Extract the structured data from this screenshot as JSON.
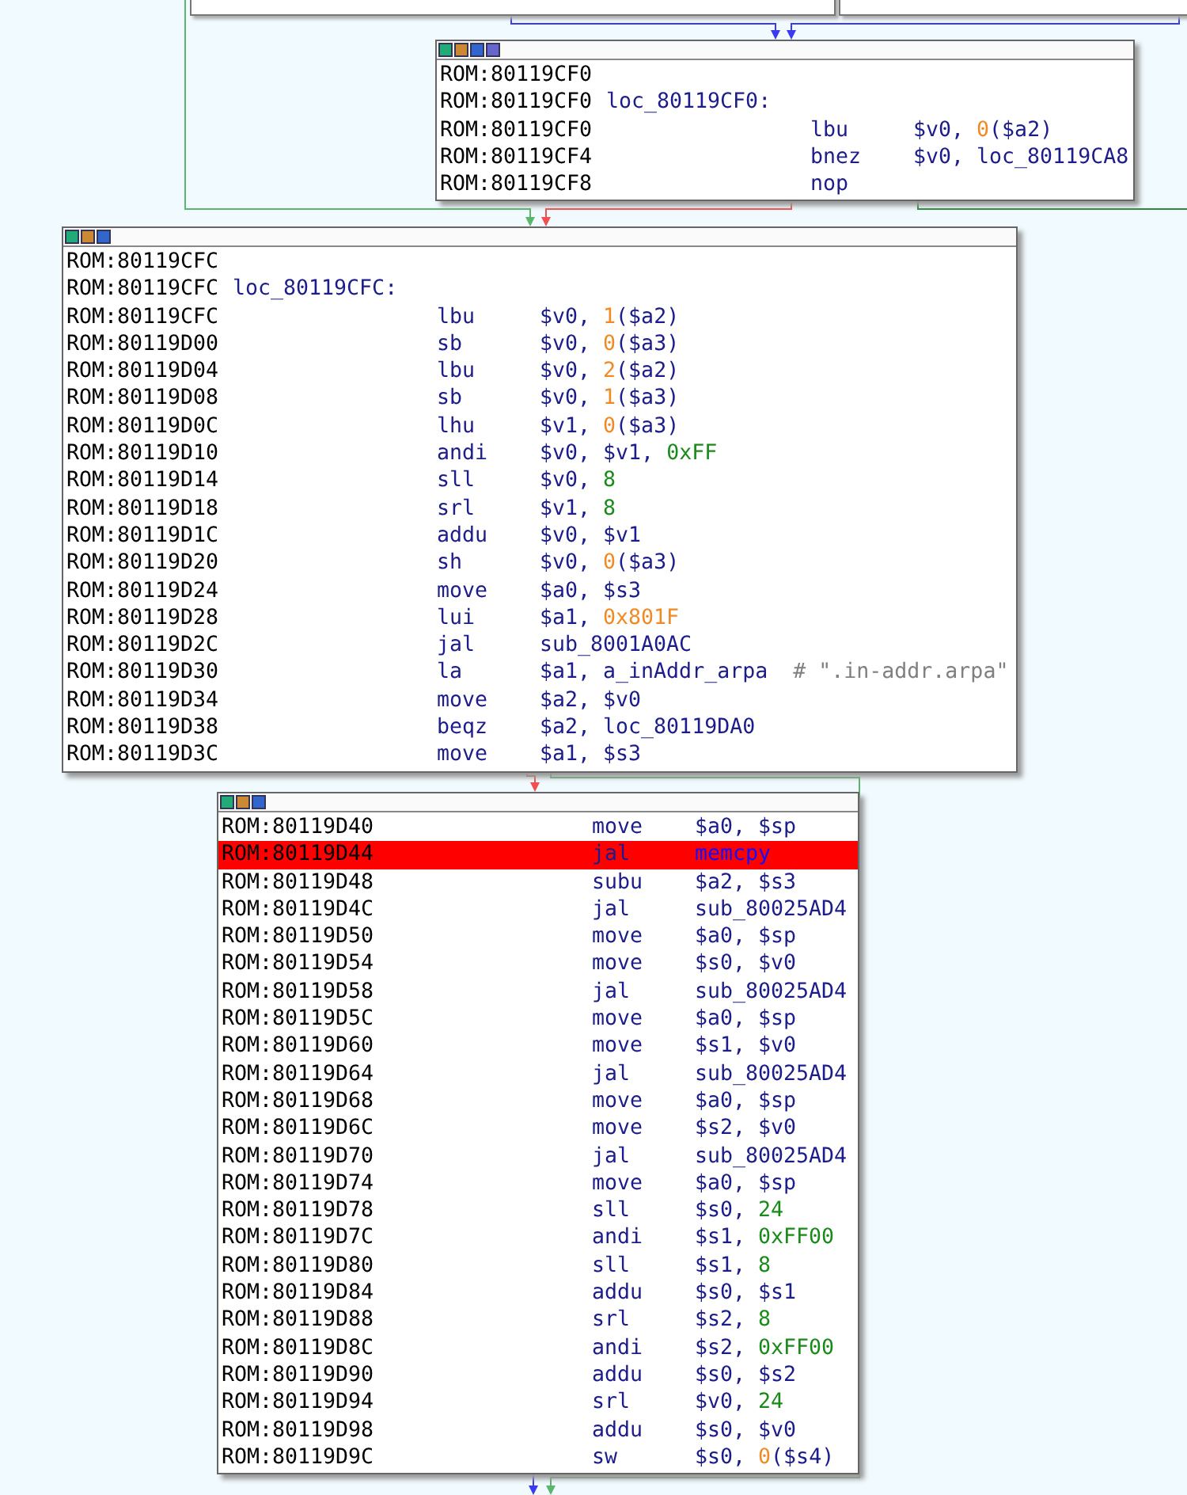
{
  "blocks": [
    {
      "lines": [
        {
          "address": "ROM:80119CF0"
        },
        {
          "address": "ROM:80119CF0",
          "label": "loc_80119CF0:"
        },
        {
          "address": "ROM:80119CF0",
          "mnemonic": "lbu",
          "operands": [
            {
              "text": "$v0, ",
              "kind": "reg"
            },
            {
              "text": "0",
              "kind": "offset"
            },
            {
              "text": "($a2)",
              "kind": "reg"
            }
          ]
        },
        {
          "address": "ROM:80119CF4",
          "mnemonic": "bnez",
          "operands": [
            {
              "text": "$v0, loc_80119CA8",
              "kind": "reg"
            }
          ]
        },
        {
          "address": "ROM:80119CF8",
          "mnemonic": "nop"
        }
      ]
    },
    {
      "lines": [
        {
          "address": "ROM:80119CFC"
        },
        {
          "address": "ROM:80119CFC",
          "label": "loc_80119CFC:"
        },
        {
          "address": "ROM:80119CFC",
          "mnemonic": "lbu",
          "operands": [
            {
              "text": "$v0, ",
              "kind": "reg"
            },
            {
              "text": "1",
              "kind": "offset"
            },
            {
              "text": "($a2)",
              "kind": "reg"
            }
          ]
        },
        {
          "address": "ROM:80119D00",
          "mnemonic": "sb",
          "operands": [
            {
              "text": "$v0, ",
              "kind": "reg"
            },
            {
              "text": "0",
              "kind": "offset"
            },
            {
              "text": "($a3)",
              "kind": "reg"
            }
          ]
        },
        {
          "address": "ROM:80119D04",
          "mnemonic": "lbu",
          "operands": [
            {
              "text": "$v0, ",
              "kind": "reg"
            },
            {
              "text": "2",
              "kind": "offset"
            },
            {
              "text": "($a2)",
              "kind": "reg"
            }
          ]
        },
        {
          "address": "ROM:80119D08",
          "mnemonic": "sb",
          "operands": [
            {
              "text": "$v0, ",
              "kind": "reg"
            },
            {
              "text": "1",
              "kind": "offset"
            },
            {
              "text": "($a3)",
              "kind": "reg"
            }
          ]
        },
        {
          "address": "ROM:80119D0C",
          "mnemonic": "lhu",
          "operands": [
            {
              "text": "$v1, ",
              "kind": "reg"
            },
            {
              "text": "0",
              "kind": "offset"
            },
            {
              "text": "($a3)",
              "kind": "reg"
            }
          ]
        },
        {
          "address": "ROM:80119D10",
          "mnemonic": "andi",
          "operands": [
            {
              "text": "$v0, $v1, ",
              "kind": "reg"
            },
            {
              "text": "0xFF",
              "kind": "const"
            }
          ]
        },
        {
          "address": "ROM:80119D14",
          "mnemonic": "sll",
          "operands": [
            {
              "text": "$v0, ",
              "kind": "reg"
            },
            {
              "text": "8",
              "kind": "const"
            }
          ]
        },
        {
          "address": "ROM:80119D18",
          "mnemonic": "srl",
          "operands": [
            {
              "text": "$v1, ",
              "kind": "reg"
            },
            {
              "text": "8",
              "kind": "const"
            }
          ]
        },
        {
          "address": "ROM:80119D1C",
          "mnemonic": "addu",
          "operands": [
            {
              "text": "$v0, $v1",
              "kind": "reg"
            }
          ]
        },
        {
          "address": "ROM:80119D20",
          "mnemonic": "sh",
          "operands": [
            {
              "text": "$v0, ",
              "kind": "reg"
            },
            {
              "text": "0",
              "kind": "offset"
            },
            {
              "text": "($a3)",
              "kind": "reg"
            }
          ]
        },
        {
          "address": "ROM:80119D24",
          "mnemonic": "move",
          "operands": [
            {
              "text": "$a0, $s3",
              "kind": "reg"
            }
          ]
        },
        {
          "address": "ROM:80119D28",
          "mnemonic": "lui",
          "operands": [
            {
              "text": "$a1, ",
              "kind": "reg"
            },
            {
              "text": "0x801F",
              "kind": "offset"
            }
          ]
        },
        {
          "address": "ROM:80119D2C",
          "mnemonic": "jal",
          "operands": [
            {
              "text": "sub_8001A0AC",
              "kind": "reg"
            }
          ]
        },
        {
          "address": "ROM:80119D30",
          "mnemonic": "la",
          "operands": [
            {
              "text": "$a1, a_inAddr_arpa",
              "kind": "reg"
            },
            {
              "text": "# \".in-addr.arpa\"",
              "kind": "comment"
            }
          ]
        },
        {
          "address": "ROM:80119D34",
          "mnemonic": "move",
          "operands": [
            {
              "text": "$a2, $v0",
              "kind": "reg"
            }
          ]
        },
        {
          "address": "ROM:80119D38",
          "mnemonic": "beqz",
          "operands": [
            {
              "text": "$a2, loc_80119DA0",
              "kind": "reg"
            }
          ]
        },
        {
          "address": "ROM:80119D3C",
          "mnemonic": "move",
          "operands": [
            {
              "text": "$a1, $s3",
              "kind": "reg"
            }
          ]
        }
      ]
    },
    {
      "lines": [
        {
          "address": "ROM:80119D40",
          "mnemonic": "move",
          "operands": [
            {
              "text": "$a0, $sp",
              "kind": "reg"
            }
          ],
          "highlighted": false
        },
        {
          "address": "ROM:80119D44",
          "mnemonic": "jal",
          "operands": [
            {
              "text": "memcpy",
              "kind": "import"
            }
          ],
          "highlighted": true
        },
        {
          "address": "ROM:80119D48",
          "mnemonic": "subu",
          "operands": [
            {
              "text": "$a2, $s3",
              "kind": "reg"
            }
          ],
          "highlighted": false
        },
        {
          "address": "ROM:80119D4C",
          "mnemonic": "jal",
          "operands": [
            {
              "text": "sub_80025AD4",
              "kind": "reg"
            }
          ],
          "highlighted": false
        },
        {
          "address": "ROM:80119D50",
          "mnemonic": "move",
          "operands": [
            {
              "text": "$a0, $sp",
              "kind": "reg"
            }
          ],
          "highlighted": false
        },
        {
          "address": "ROM:80119D54",
          "mnemonic": "move",
          "operands": [
            {
              "text": "$s0, $v0",
              "kind": "reg"
            }
          ],
          "highlighted": false
        },
        {
          "address": "ROM:80119D58",
          "mnemonic": "jal",
          "operands": [
            {
              "text": "sub_80025AD4",
              "kind": "reg"
            }
          ],
          "highlighted": false
        },
        {
          "address": "ROM:80119D5C",
          "mnemonic": "move",
          "operands": [
            {
              "text": "$a0, $sp",
              "kind": "reg"
            }
          ],
          "highlighted": false
        },
        {
          "address": "ROM:80119D60",
          "mnemonic": "move",
          "operands": [
            {
              "text": "$s1, $v0",
              "kind": "reg"
            }
          ],
          "highlighted": false
        },
        {
          "address": "ROM:80119D64",
          "mnemonic": "jal",
          "operands": [
            {
              "text": "sub_80025AD4",
              "kind": "reg"
            }
          ],
          "highlighted": false
        },
        {
          "address": "ROM:80119D68",
          "mnemonic": "move",
          "operands": [
            {
              "text": "$a0, $sp",
              "kind": "reg"
            }
          ],
          "highlighted": false
        },
        {
          "address": "ROM:80119D6C",
          "mnemonic": "move",
          "operands": [
            {
              "text": "$s2, $v0",
              "kind": "reg"
            }
          ],
          "highlighted": false
        },
        {
          "address": "ROM:80119D70",
          "mnemonic": "jal",
          "operands": [
            {
              "text": "sub_80025AD4",
              "kind": "reg"
            }
          ],
          "highlighted": false
        },
        {
          "address": "ROM:80119D74",
          "mnemonic": "move",
          "operands": [
            {
              "text": "$a0, $sp",
              "kind": "reg"
            }
          ],
          "highlighted": false
        },
        {
          "address": "ROM:80119D78",
          "mnemonic": "sll",
          "operands": [
            {
              "text": "$s0, ",
              "kind": "reg"
            },
            {
              "text": "24",
              "kind": "const"
            }
          ],
          "highlighted": false
        },
        {
          "address": "ROM:80119D7C",
          "mnemonic": "andi",
          "operands": [
            {
              "text": "$s1, ",
              "kind": "reg"
            },
            {
              "text": "0xFF00",
              "kind": "const"
            }
          ],
          "highlighted": false
        },
        {
          "address": "ROM:80119D80",
          "mnemonic": "sll",
          "operands": [
            {
              "text": "$s1, ",
              "kind": "reg"
            },
            {
              "text": "8",
              "kind": "const"
            }
          ],
          "highlighted": false
        },
        {
          "address": "ROM:80119D84",
          "mnemonic": "addu",
          "operands": [
            {
              "text": "$s0, $s1",
              "kind": "reg"
            }
          ],
          "highlighted": false
        },
        {
          "address": "ROM:80119D88",
          "mnemonic": "srl",
          "operands": [
            {
              "text": "$s2, ",
              "kind": "reg"
            },
            {
              "text": "8",
              "kind": "const"
            }
          ],
          "highlighted": false
        },
        {
          "address": "ROM:80119D8C",
          "mnemonic": "andi",
          "operands": [
            {
              "text": "$s2, ",
              "kind": "reg"
            },
            {
              "text": "0xFF00",
              "kind": "const"
            }
          ],
          "highlighted": false
        },
        {
          "address": "ROM:80119D90",
          "mnemonic": "addu",
          "operands": [
            {
              "text": "$s0, $s2",
              "kind": "reg"
            }
          ],
          "highlighted": false
        },
        {
          "address": "ROM:80119D94",
          "mnemonic": "srl",
          "operands": [
            {
              "text": "$v0, ",
              "kind": "reg"
            },
            {
              "text": "24",
              "kind": "const"
            }
          ],
          "highlighted": false
        },
        {
          "address": "ROM:80119D98",
          "mnemonic": "addu",
          "operands": [
            {
              "text": "$s0, $v0",
              "kind": "reg"
            }
          ],
          "highlighted": false
        },
        {
          "address": "ROM:80119D9C",
          "mnemonic": "sw",
          "operands": [
            {
              "text": "$s0, ",
              "kind": "reg"
            },
            {
              "text": "0",
              "kind": "offset"
            },
            {
              "text": "($s4)",
              "kind": "reg"
            }
          ],
          "highlighted": false
        }
      ]
    }
  ]
}
